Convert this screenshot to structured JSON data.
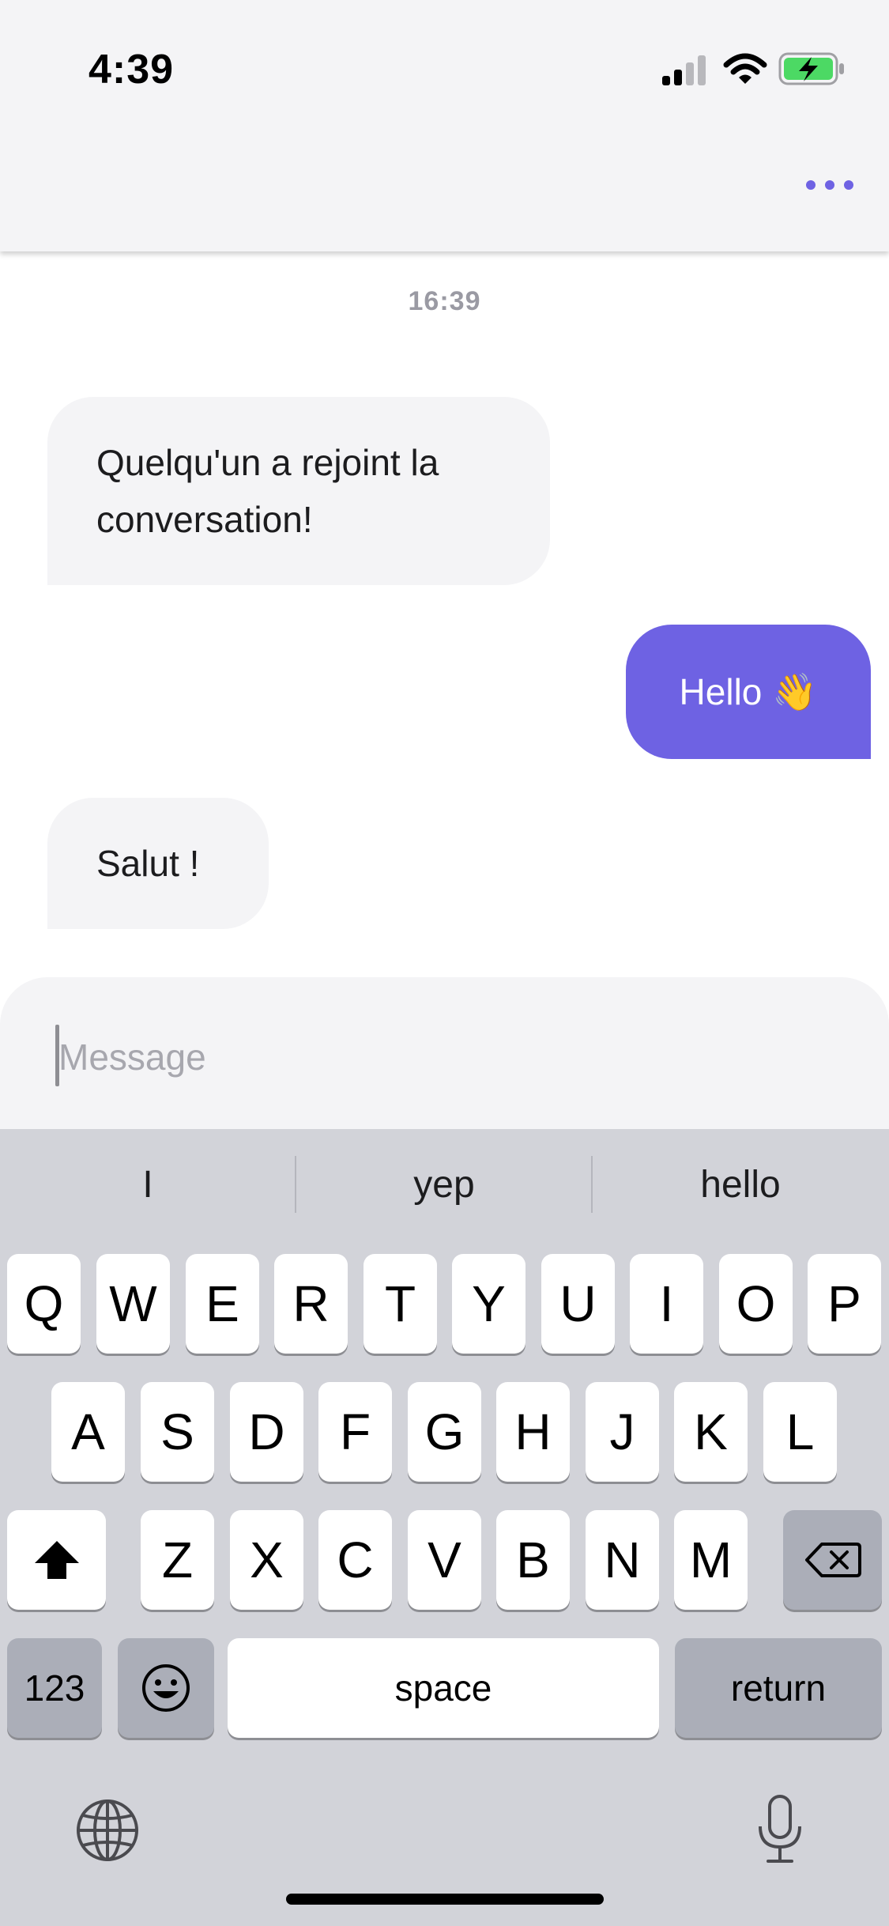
{
  "status_bar": {
    "time": "4:39",
    "icons": [
      "signal-icon",
      "wifi-icon",
      "battery-charging-icon"
    ],
    "battery_color": "#4cd964"
  },
  "header": {
    "menu_icon": "more-dots-icon",
    "accent_color": "#6e62e3"
  },
  "chat": {
    "timestamp": "16:39",
    "messages": [
      {
        "direction": "incoming",
        "text": "Quelqu'un a rejoint la conversation!"
      },
      {
        "direction": "outgoing",
        "text": "Hello 👋"
      },
      {
        "direction": "incoming",
        "text": "Salut !"
      }
    ]
  },
  "composer": {
    "placeholder": "Message",
    "value": ""
  },
  "keyboard": {
    "suggestions": [
      "I",
      "yep",
      "hello"
    ],
    "row1": [
      "Q",
      "W",
      "E",
      "R",
      "T",
      "Y",
      "U",
      "I",
      "O",
      "P"
    ],
    "row2": [
      "A",
      "S",
      "D",
      "F",
      "G",
      "H",
      "J",
      "K",
      "L"
    ],
    "row3": [
      "Z",
      "X",
      "C",
      "V",
      "B",
      "N",
      "M"
    ],
    "numbers_label": "123",
    "space_label": "space",
    "return_label": "return",
    "icons": [
      "shift-icon",
      "backspace-icon",
      "emoji-icon",
      "globe-icon",
      "microphone-icon"
    ]
  }
}
